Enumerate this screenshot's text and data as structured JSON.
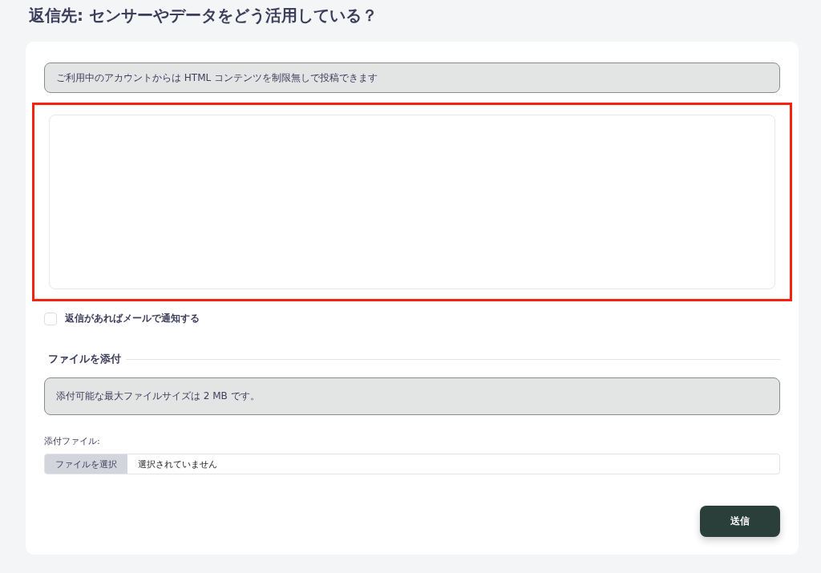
{
  "title": "返信先: センサーやデータをどう活用している？",
  "notice": "ご利用中のアカウントからは HTML コンテンツを制限無しで投稿できます",
  "notify": {
    "label": "返信があればメールで通知する",
    "checked": false
  },
  "attachments": {
    "heading": "ファイルを添付",
    "info": "添付可能な最大ファイルサイズは 2 MB です。",
    "label": "添付ファイル:",
    "button": "ファイルを選択",
    "status": "選択されていません"
  },
  "submit": "送信"
}
